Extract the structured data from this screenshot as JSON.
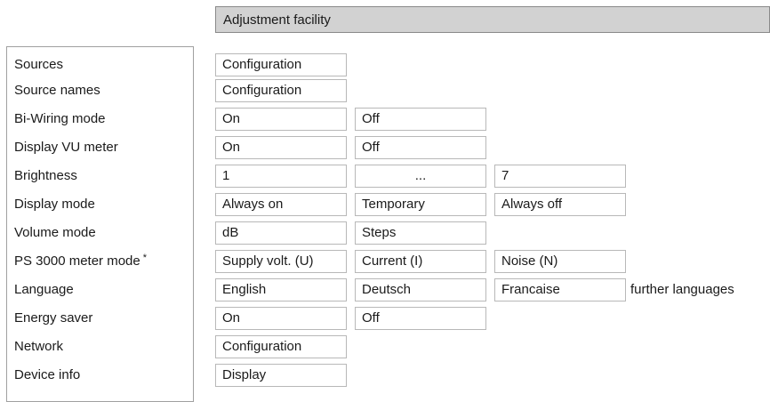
{
  "header": {
    "title": "Adjustment facility"
  },
  "rows": [
    {
      "label": "Sources",
      "options": [
        "Configuration"
      ]
    },
    {
      "label": "Source names",
      "options": [
        "Configuration"
      ]
    },
    {
      "label": "Bi-Wiring mode",
      "options": [
        "On",
        "Off"
      ]
    },
    {
      "label": "Display VU meter",
      "options": [
        "On",
        "Off"
      ]
    },
    {
      "label": "Brightness",
      "options": [
        "1",
        "...",
        "7"
      ]
    },
    {
      "label": "Display mode",
      "options": [
        "Always on",
        "Temporary",
        "Always off"
      ]
    },
    {
      "label": "Volume mode",
      "options": [
        "dB",
        "Steps"
      ]
    },
    {
      "label": "PS 3000 meter mode",
      "mark": "*",
      "options": [
        "Supply volt.  (U)",
        "Current (I)",
        "Noise (N)"
      ]
    },
    {
      "label": "Language",
      "options": [
        "English",
        "Deutsch",
        "Francaise"
      ],
      "extra": "further languages"
    },
    {
      "label": "Energy saver",
      "options": [
        "On",
        "Off"
      ]
    },
    {
      "label": "Network",
      "options": [
        "Configuration"
      ]
    },
    {
      "label": "Device info",
      "options": [
        "Display"
      ]
    }
  ]
}
